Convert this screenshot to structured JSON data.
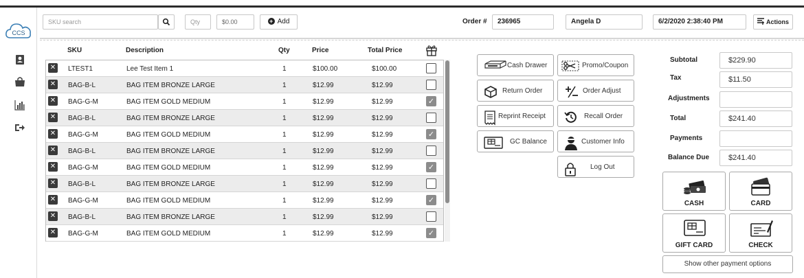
{
  "logo_text": "CCS",
  "header": {
    "sku_placeholder": "SKU search",
    "qty_placeholder": "Qty",
    "price_value": "$0.00",
    "add_label": "Add",
    "order_label": "Order #",
    "order_number": "236965",
    "cashier": "Angela D",
    "datetime": "6/2/2020  2:38:40 PM",
    "actions_label": "Actions"
  },
  "grid": {
    "columns": [
      "SKU",
      "Description",
      "Qty",
      "Price",
      "Total Price"
    ],
    "rows": [
      {
        "sku": "LTEST1",
        "description": "Lee Test Item 1",
        "qty": "1",
        "price": "$100.00",
        "total": "$100.00",
        "gift": false
      },
      {
        "sku": "BAG-B-L",
        "description": "BAG ITEM BRONZE LARGE",
        "qty": "1",
        "price": "$12.99",
        "total": "$12.99",
        "gift": false
      },
      {
        "sku": "BAG-G-M",
        "description": "BAG ITEM GOLD MEDIUM",
        "qty": "1",
        "price": "$12.99",
        "total": "$12.99",
        "gift": true
      },
      {
        "sku": "BAG-B-L",
        "description": "BAG ITEM BRONZE LARGE",
        "qty": "1",
        "price": "$12.99",
        "total": "$12.99",
        "gift": false
      },
      {
        "sku": "BAG-G-M",
        "description": "BAG ITEM GOLD MEDIUM",
        "qty": "1",
        "price": "$12.99",
        "total": "$12.99",
        "gift": true
      },
      {
        "sku": "BAG-B-L",
        "description": "BAG ITEM BRONZE LARGE",
        "qty": "1",
        "price": "$12.99",
        "total": "$12.99",
        "gift": false
      },
      {
        "sku": "BAG-G-M",
        "description": "BAG ITEM GOLD MEDIUM",
        "qty": "1",
        "price": "$12.99",
        "total": "$12.99",
        "gift": true
      },
      {
        "sku": "BAG-B-L",
        "description": "BAG ITEM BRONZE LARGE",
        "qty": "1",
        "price": "$12.99",
        "total": "$12.99",
        "gift": false
      },
      {
        "sku": "BAG-G-M",
        "description": "BAG ITEM GOLD MEDIUM",
        "qty": "1",
        "price": "$12.99",
        "total": "$12.99",
        "gift": true
      },
      {
        "sku": "BAG-B-L",
        "description": "BAG ITEM BRONZE LARGE",
        "qty": "1",
        "price": "$12.99",
        "total": "$12.99",
        "gift": false
      },
      {
        "sku": "BAG-G-M",
        "description": "BAG ITEM GOLD MEDIUM",
        "qty": "1",
        "price": "$12.99",
        "total": "$12.99",
        "gift": true
      }
    ]
  },
  "actions": {
    "cash_drawer": "Cash Drawer",
    "promo_coupon": "Promo/Coupon",
    "return_order": "Return Order",
    "order_adjust": "Order Adjust",
    "reprint_receipt": "Reprint Receipt",
    "recall_order": "Recall Order",
    "gc_balance": "GC Balance",
    "customer_info": "Customer Info",
    "log_out": "Log Out"
  },
  "totals": {
    "subtotal_label": "Subtotal",
    "subtotal": "$229.90",
    "tax_label": "Tax",
    "tax": "$11.50",
    "adjustments_label": "Adjustments",
    "adjustments": "",
    "total_label": "Total",
    "total": "$241.40",
    "payments_label": "Payments",
    "payments": "",
    "balance_label": "Balance Due",
    "balance": "$241.40"
  },
  "payment": {
    "cash": "CASH",
    "card": "CARD",
    "gift_card": "GIFT CARD",
    "check": "CHECK",
    "other": "Show other payment options"
  },
  "icons": {
    "search": "search-icon",
    "add": "plus-circle-icon",
    "actions": "menu-lines-icon",
    "gift": "gift-icon",
    "remove": "close-icon",
    "check": "checkmark-icon"
  },
  "colors": {
    "dark": "#2b2b2b",
    "row_alt": "#ececec",
    "checked": "#8c8c8c",
    "logo": "#3b7fb5"
  }
}
